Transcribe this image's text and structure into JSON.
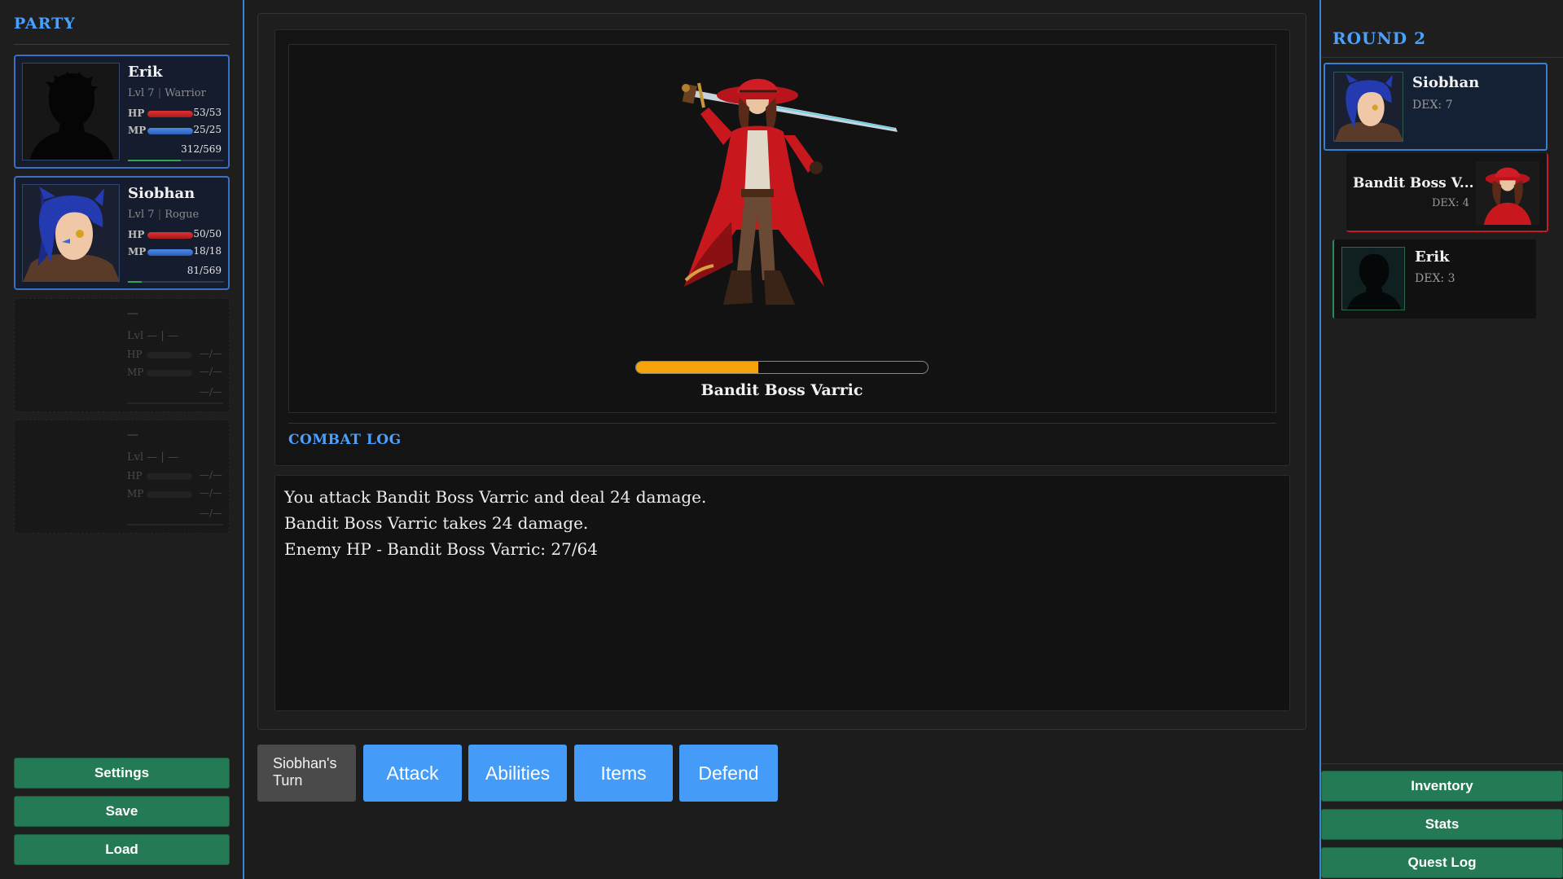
{
  "party": {
    "title": "PARTY",
    "members": [
      {
        "name": "Erik",
        "level": "Lvl 7",
        "cls": "Warrior",
        "hp_label": "HP",
        "hp": "53/53",
        "hp_pct": 100,
        "mp_label": "MP",
        "mp": "25/25",
        "mp_pct": 100,
        "xp": "312/569",
        "xp_pct": 55
      },
      {
        "name": "Siobhan",
        "level": "Lvl 7",
        "cls": "Rogue",
        "hp_label": "HP",
        "hp": "50/50",
        "hp_pct": 100,
        "mp_label": "MP",
        "mp": "18/18",
        "mp_pct": 100,
        "xp": "81/569",
        "xp_pct": 14
      },
      {
        "name": "—",
        "level": "Lvl —",
        "cls": "—",
        "hp_label": "HP",
        "hp": "—/—",
        "mp_label": "MP",
        "mp": "—/—",
        "xp": "—/—"
      },
      {
        "name": "—",
        "level": "Lvl —",
        "cls": "—",
        "hp_label": "HP",
        "hp": "—/—",
        "mp_label": "MP",
        "mp": "—/—",
        "xp": "—/—"
      }
    ],
    "separator": "|",
    "buttons": {
      "settings": "Settings",
      "save": "Save",
      "load": "Load"
    }
  },
  "enemy": {
    "name": "Bandit Boss Varric",
    "hp_pct": 42
  },
  "combat_log": {
    "title": "COMBAT LOG",
    "lines": [
      "You attack Bandit Boss Varric and deal 24 damage.",
      "Bandit Boss Varric takes 24 damage.",
      "Enemy HP - Bandit Boss Varric: 27/64"
    ]
  },
  "actions": {
    "turn": "Siobhan's Turn",
    "attack": "Attack",
    "abilities": "Abilities",
    "items": "Items",
    "defend": "Defend"
  },
  "turn_order": {
    "round": "ROUND 2",
    "entries": [
      {
        "name": "Siobhan",
        "dex": "DEX: 7"
      },
      {
        "name": "Bandit Boss V...",
        "dex": "DEX: 4"
      },
      {
        "name": "Erik",
        "dex": "DEX: 3"
      }
    ]
  },
  "right_buttons": {
    "inventory": "Inventory",
    "stats": "Stats",
    "quest_log": "Quest Log"
  },
  "colors": {
    "accent": "#4aa0ff",
    "action": "#449cf8",
    "menu": "#247a55",
    "enemy_hp": "#f5a30a",
    "hp": "#c62828",
    "mp": "#3a73d0"
  }
}
